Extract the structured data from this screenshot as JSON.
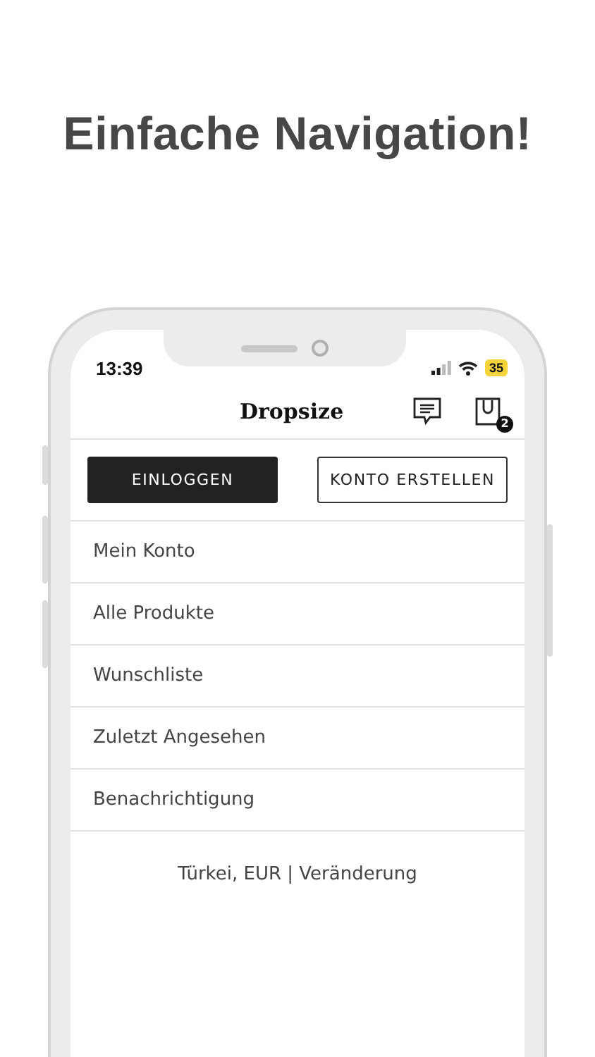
{
  "headline": "Einfache Navigation!",
  "status_bar": {
    "time": "13:39",
    "battery": "35"
  },
  "header": {
    "logo": "Dropsize",
    "cart_count": "2"
  },
  "buttons": [
    {
      "label": "EINLOGGEN",
      "kind": "primary"
    },
    {
      "label": "KONTO ERSTELLEN",
      "kind": "secondary"
    }
  ],
  "menu": [
    "Mein Konto",
    "Alle Produkte",
    "Wunschliste",
    "Zuletzt Angesehen",
    "Benachrichtigung"
  ],
  "footer": "Türkei, EUR | Veränderung"
}
